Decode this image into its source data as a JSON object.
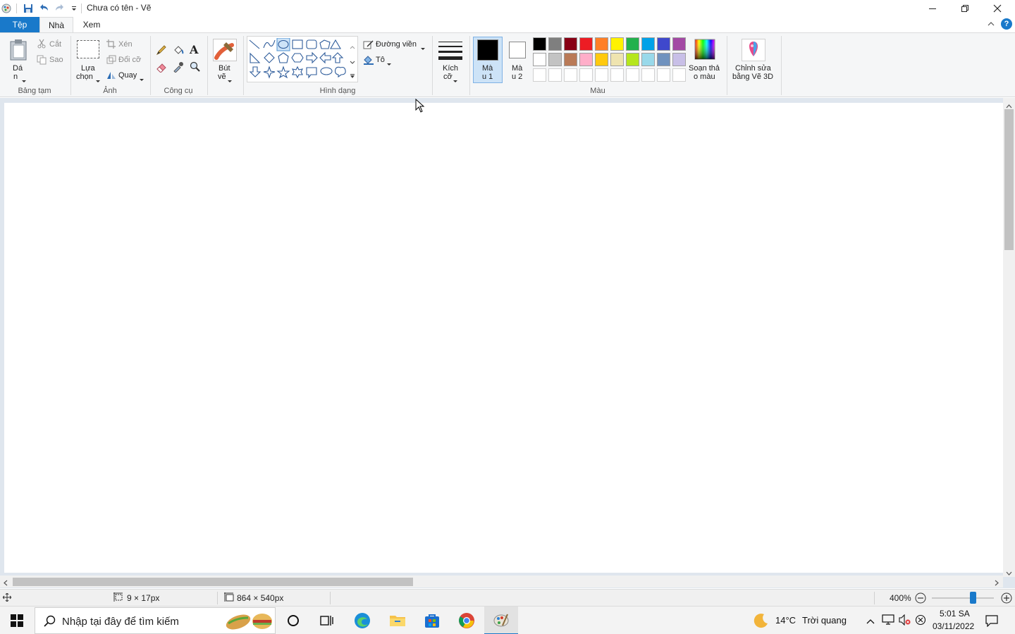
{
  "window": {
    "title": "Chưa có tên - Vẽ",
    "minimize_icon": "minimize-icon",
    "restore_icon": "restore-icon",
    "close_icon": "close-icon"
  },
  "tabs": {
    "file": "Tệp",
    "home": "Nhà",
    "view": "Xem"
  },
  "ribbon": {
    "clipboard": {
      "paste_label_1": "Dá",
      "paste_label_2": "n",
      "cut": "Cắt",
      "copy": "Sao",
      "group": "Bảng tạm"
    },
    "image": {
      "select_1": "Lựa",
      "select_2": "chọn",
      "crop": "Xén",
      "resize": "Đổi cỡ",
      "rotate": "Quay",
      "group": "Ảnh"
    },
    "tools": {
      "group": "Công cụ"
    },
    "brushes": {
      "label_1": "Bút",
      "label_2": "vẽ"
    },
    "shapes": {
      "outline": "Đường viền",
      "fill": "Tô",
      "group": "Hình dạng"
    },
    "size": {
      "label_1": "Kích",
      "label_2": "cỡ"
    },
    "colors": {
      "color1_1": "Mà",
      "color1_2": "u 1",
      "color2_1": "Mà",
      "color2_2": "u 2",
      "edit_colors_1": "Soạn thả",
      "edit_colors_2": "o màu",
      "paint3d_1": "Chỉnh sửa",
      "paint3d_2": "bằng Vẽ 3D",
      "group": "Màu",
      "color1": "#000000",
      "color2": "#ffffff",
      "palette_row1": [
        "#000000",
        "#7f7f7f",
        "#880015",
        "#ed1c24",
        "#ff7f27",
        "#fff200",
        "#22b14c",
        "#00a2e8",
        "#3f48cc",
        "#a349a4"
      ],
      "palette_row2": [
        "#ffffff",
        "#c3c3c3",
        "#b97a57",
        "#ffaec9",
        "#ffc90e",
        "#efe4b0",
        "#b5e61d",
        "#99d9ea",
        "#7092be",
        "#c8bfe7"
      ]
    }
  },
  "status": {
    "cursor_pos": "9 × 17px",
    "canvas_size": "864 × 540px",
    "zoom": "400%"
  },
  "taskbar": {
    "search_placeholder": "Nhập tại đây để tìm kiếm",
    "weather_temp": "14°C",
    "weather_text": "Trời quang",
    "time": "5:01 SA",
    "date": "03/11/2022"
  }
}
